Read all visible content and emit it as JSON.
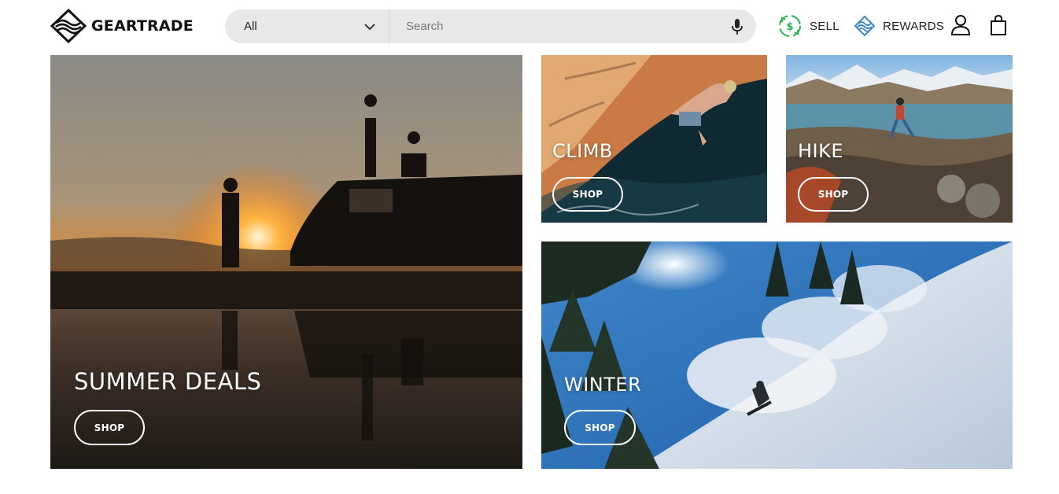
{
  "brand": {
    "name": "GEARTRADE"
  },
  "search": {
    "category": "All",
    "placeholder": "Search"
  },
  "nav": {
    "sell_label": "SELL",
    "rewards_label": "REWARDS"
  },
  "icons": {
    "logo": "wave-diamond-logo-icon",
    "dropdown": "chevron-down-icon",
    "mic": "microphone-icon",
    "sell": "recycle-arrows-icon",
    "rewards": "wave-diamond-icon",
    "account": "user-icon",
    "cart": "shopping-bag-icon"
  },
  "colors": {
    "sell_accent": "#2bb24c",
    "rewards_accent": "#3a86c8",
    "search_bg": "#e8e8e8"
  },
  "tiles": {
    "summer": {
      "title": "SUMMER DEALS",
      "button": "SHOP"
    },
    "climb": {
      "title": "CLIMB",
      "button": "SHOP"
    },
    "hike": {
      "title": "HIKE",
      "button": "SHOP"
    },
    "winter": {
      "title": "WINTER",
      "button": "SHOP"
    }
  }
}
